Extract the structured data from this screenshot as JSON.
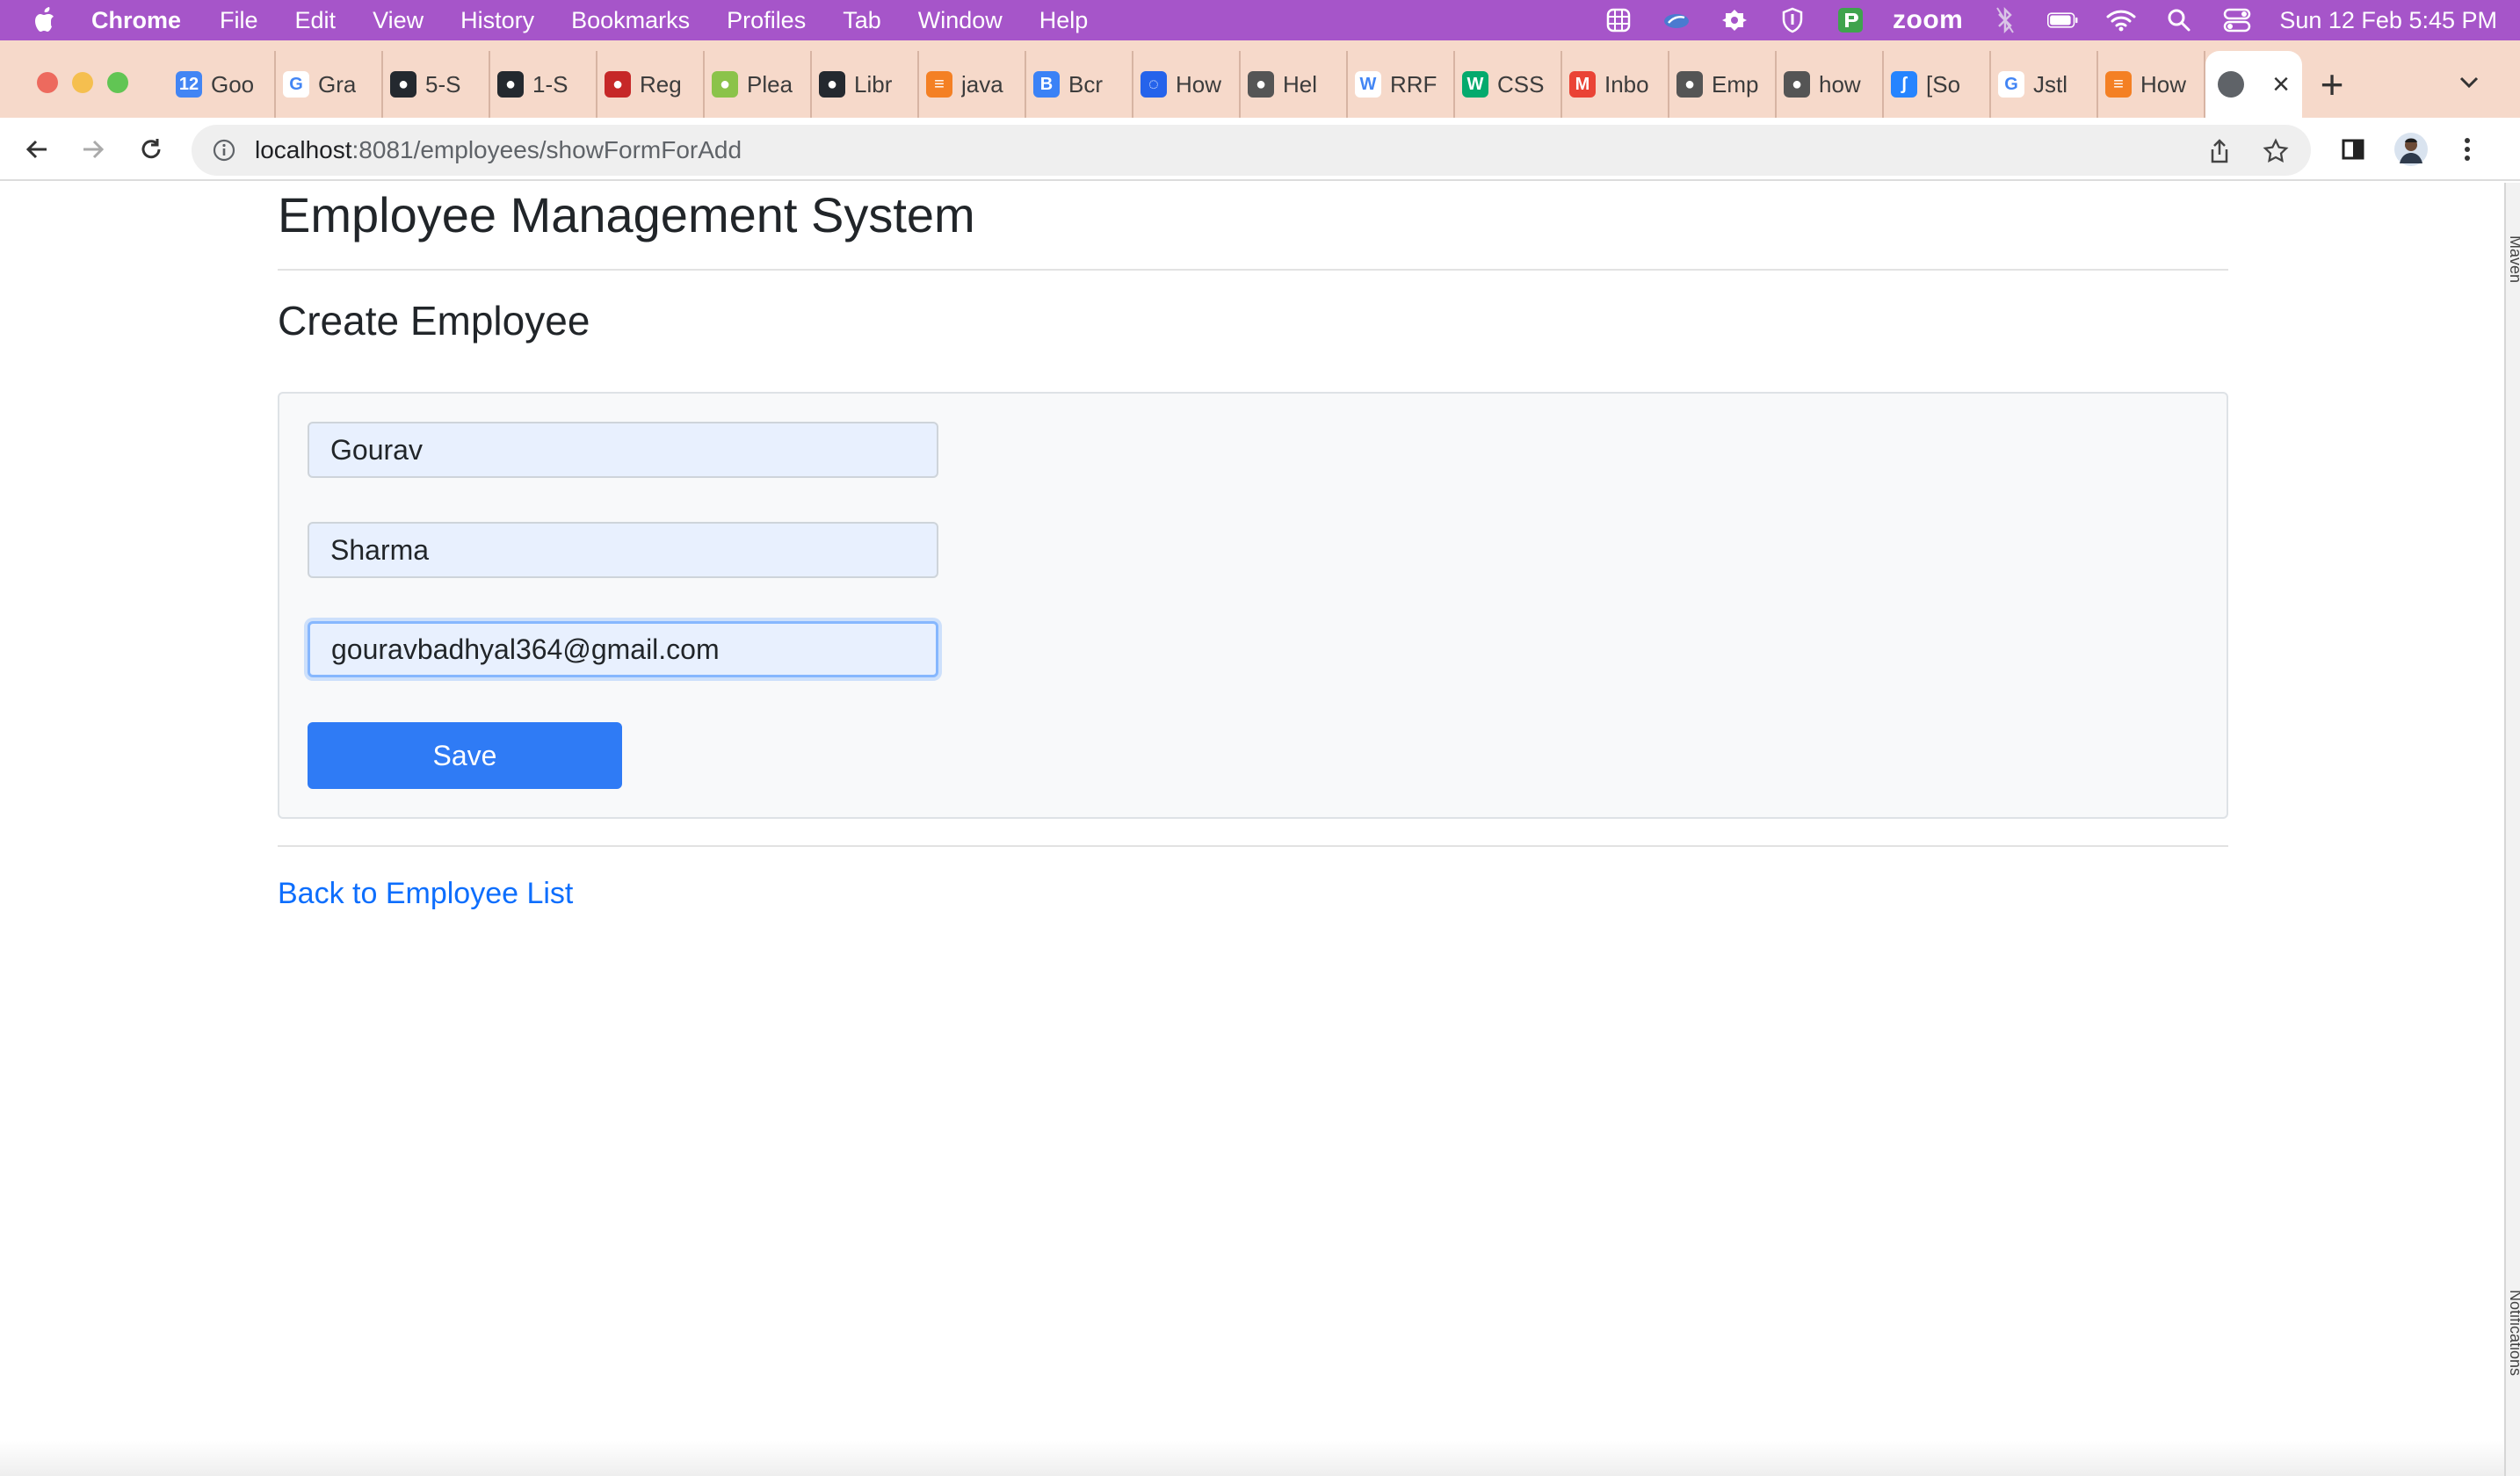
{
  "menubar": {
    "app_name": "Chrome",
    "items": [
      "File",
      "Edit",
      "View",
      "History",
      "Bookmarks",
      "Profiles",
      "Tab",
      "Window",
      "Help"
    ],
    "zoom_label": "zoom",
    "clock": "Sun 12 Feb  5:45 PM"
  },
  "tabs": [
    {
      "label": "Goo",
      "icon": "google-calendar-icon",
      "color": "#4285f4",
      "glyph": "12"
    },
    {
      "label": "Gra",
      "icon": "google-icon",
      "color": "#ffffff",
      "glyph": "G"
    },
    {
      "label": "5-S",
      "icon": "github-icon",
      "color": "#24292f",
      "glyph": "●"
    },
    {
      "label": "1-S",
      "icon": "github-icon",
      "color": "#24292f",
      "glyph": "●"
    },
    {
      "label": "Reg",
      "icon": "redis-icon",
      "color": "#c62828",
      "glyph": "●"
    },
    {
      "label": "Plea",
      "icon": "spring-leaf-icon",
      "color": "#8bc34a",
      "glyph": "●"
    },
    {
      "label": "Libr",
      "icon": "github-icon",
      "color": "#24292f",
      "glyph": "●"
    },
    {
      "label": "java",
      "icon": "stackoverflow-icon",
      "color": "#f48024",
      "glyph": "≡"
    },
    {
      "label": "Bcr",
      "icon": "b-letter-icon",
      "color": "#3b82f6",
      "glyph": "B"
    },
    {
      "label": "How",
      "icon": "loop-icon",
      "color": "#2563eb",
      "glyph": "◌"
    },
    {
      "label": "Hel",
      "icon": "globe-icon",
      "color": "#555555",
      "glyph": "●"
    },
    {
      "label": "RRF",
      "icon": "wikipedia-icon",
      "color": "#ffffff",
      "glyph": "W"
    },
    {
      "label": "CSS",
      "icon": "w3schools-icon",
      "color": "#04aa6d",
      "glyph": "W"
    },
    {
      "label": "Inbo",
      "icon": "gmail-icon",
      "color": "#ea4335",
      "glyph": "M"
    },
    {
      "label": "Emp",
      "icon": "globe-icon",
      "color": "#555555",
      "glyph": "●"
    },
    {
      "label": "how",
      "icon": "globe-icon",
      "color": "#555555",
      "glyph": "●"
    },
    {
      "label": "[So",
      "icon": "atlassian-icon",
      "color": "#2684ff",
      "glyph": "ʃ"
    },
    {
      "label": "Jstl",
      "icon": "google-icon",
      "color": "#ffffff",
      "glyph": "G"
    },
    {
      "label": "How",
      "icon": "stackoverflow-icon",
      "color": "#f48024",
      "glyph": "≡"
    }
  ],
  "toolbar": {
    "url_host": "localhost",
    "url_path": ":8081/employees/showFormForAdd"
  },
  "page": {
    "title": "Employee Management System",
    "subtitle": "Create Employee",
    "first_name": "Gourav",
    "last_name": "Sharma",
    "email": "gouravbadhyal364@gmail.com",
    "save_label": "Save",
    "back_link": "Back to Employee List"
  },
  "right_edge": {
    "top_label": "Maven",
    "bottom_label": "Notifications"
  },
  "colors": {
    "menubar": "#a655c9",
    "tabstrip": "#f6d9ca",
    "primary_button": "#2f7bf5",
    "link": "#0d6efd",
    "autofill_field": "#e8f0fe"
  }
}
